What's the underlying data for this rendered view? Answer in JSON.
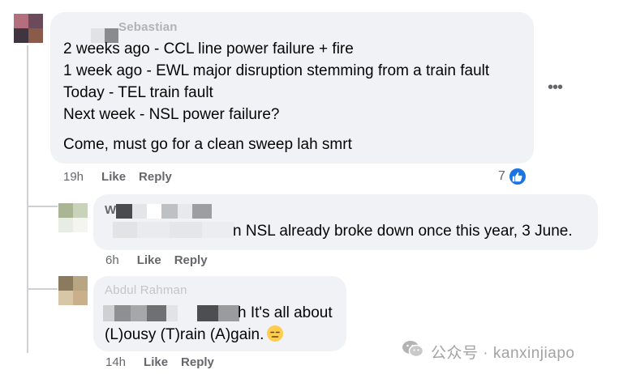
{
  "comments": [
    {
      "author_masked": "Sebastian",
      "lines": [
        "2 weeks ago - CCL line power failure + fire",
        "1 week ago - EWL major disruption stemming from a train fault",
        "Today - TEL train fault",
        "Next week - NSL power failure?",
        "Come, must go for a clean sweep lah smrt"
      ],
      "time": "19h",
      "like_label": "Like",
      "reply_label": "Reply",
      "reaction_count": "7",
      "reaction_icon": "thumbs-up-icon"
    },
    {
      "author_masked": "W",
      "lines": [
        "n NSL already broke down once this year, 3 June."
      ],
      "time": "6h",
      "like_label": "Like",
      "reply_label": "Reply"
    },
    {
      "author_masked": "Abdul Rahman",
      "lines": [
        "h It's all about",
        "(L)ousy (T)rain (A)gain."
      ],
      "emoji": "expressionless-face-emoji",
      "time": "14h",
      "like_label": "Like",
      "reply_label": "Reply"
    }
  ],
  "more_options_icon": "more-horizontal-icon",
  "watermark": {
    "icon": "wechat-icon",
    "text": "公众号 · kanxinjiapo"
  },
  "colors": {
    "bubble": "#f0f2f5",
    "like_blue": "#1b74e4",
    "meta_gray": "#65676b"
  }
}
